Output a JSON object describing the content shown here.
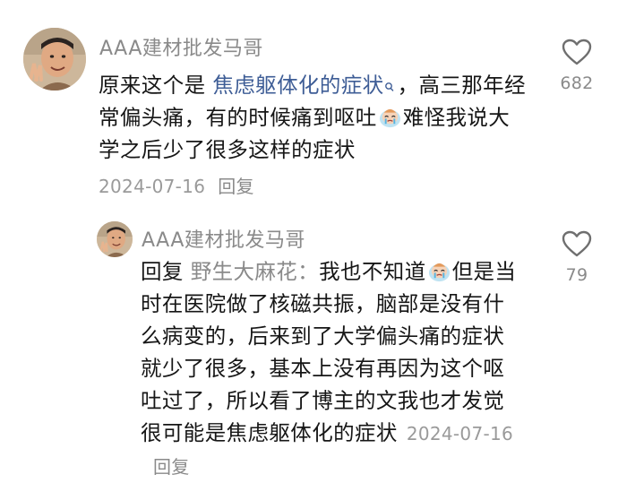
{
  "comments": [
    {
      "username": "AAA建材批发马哥",
      "text_before": "原来这个是 ",
      "topic": "焦虑躯体化的症状",
      "text_after_topic": "，高三那年经常偏头痛，有的时候痛到呕吐",
      "text_end": "难怪我说大学之后少了很多这样的症状",
      "emoji": "crying-face-emoji",
      "date": "2024-07-16",
      "reply_label": "回复",
      "likes": "682"
    },
    {
      "username": "AAA建材批发马哥",
      "reply_prefix": "回复",
      "reply_to": "野生大麻花：",
      "text_before": "我也不知道",
      "text_after": "但是当时在医院做了核磁共振，脑部是没有什么病变的，后来到了大学偏头痛的症状就少了很多，基本上没有再因为这个呕吐过了，所以看了博主的文我也才发觉很可能是焦虑躯体化的症状",
      "emoji": "crying-face-emoji",
      "date": "2024-07-16",
      "reply_label": "回复",
      "likes": "79"
    }
  ],
  "icons": {
    "like": "heart-outline-icon",
    "search": "search-icon"
  },
  "colors": {
    "topic_link": "#3e5d96",
    "muted": "#8a8a8a",
    "text": "#161616"
  }
}
